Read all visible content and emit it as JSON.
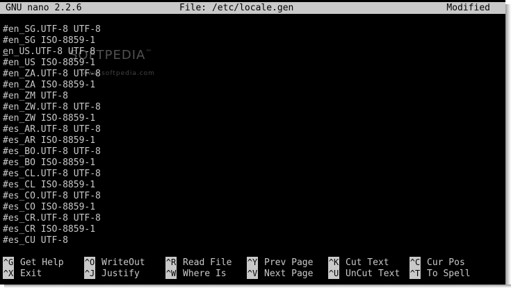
{
  "titlebar": {
    "app": "GNU nano 2.2.6",
    "file": "File: /etc/locale.gen",
    "status": "Modified"
  },
  "watermark": {
    "text": "SOFTPEDIA",
    "trademark": "™",
    "sub": "www.softpedia.com"
  },
  "lines": [
    "#en_SG.UTF-8 UTF-8",
    "#en_SG ISO-8859-1",
    "en_US.UTF-8 UTF-8",
    "#en_US ISO-8859-1",
    "#en_ZA.UTF-8 UTF-8",
    "#en_ZA ISO-8859-1",
    "#en_ZM UTF-8",
    "#en_ZW.UTF-8 UTF-8",
    "#en_ZW ISO-8859-1",
    "#es_AR.UTF-8 UTF-8",
    "#es_AR ISO-8859-1",
    "#es_BO.UTF-8 UTF-8",
    "#es_BO ISO-8859-1",
    "#es_CL.UTF-8 UTF-8",
    "#es_CL ISO-8859-1",
    "#es_CO.UTF-8 UTF-8",
    "#es_CO ISO-8859-1",
    "#es_CR.UTF-8 UTF-8",
    "#es_CR ISO-8859-1",
    "#es_CU UTF-8"
  ],
  "shortcuts": [
    {
      "key": "^G",
      "label": "Get Help"
    },
    {
      "key": "^O",
      "label": "WriteOut"
    },
    {
      "key": "^R",
      "label": "Read File"
    },
    {
      "key": "^Y",
      "label": "Prev Page"
    },
    {
      "key": "^K",
      "label": "Cut Text"
    },
    {
      "key": "^C",
      "label": "Cur Pos"
    },
    {
      "key": "^X",
      "label": "Exit"
    },
    {
      "key": "^J",
      "label": "Justify"
    },
    {
      "key": "^W",
      "label": "Where Is"
    },
    {
      "key": "^V",
      "label": "Next Page"
    },
    {
      "key": "^U",
      "label": "UnCut Text"
    },
    {
      "key": "^T",
      "label": "To Spell"
    }
  ],
  "colors": {
    "background": "#000000",
    "foreground": "#c9c9c9",
    "inverse_bg": "#c9c9c9",
    "inverse_fg": "#000000"
  }
}
